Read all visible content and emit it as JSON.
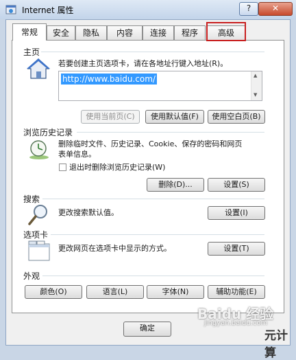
{
  "window": {
    "title": "Internet 属性",
    "help_label": "?",
    "close_label": "✕"
  },
  "tabs": [
    {
      "label": "常规",
      "active": true
    },
    {
      "label": "安全"
    },
    {
      "label": "隐私"
    },
    {
      "label": "内容"
    },
    {
      "label": "连接"
    },
    {
      "label": "程序"
    },
    {
      "label": "高级"
    }
  ],
  "home": {
    "label": "主页",
    "description": "若要创建主页选项卡，请在各地址行键入地址(R)。",
    "url": "http://www.baidu.com/",
    "use_current": "使用当前页(C)",
    "use_default": "使用默认值(F)",
    "use_blank": "使用空白页(B)"
  },
  "history": {
    "label": "浏览历史记录",
    "description_line1": "删除临时文件、历史记录、Cookie、保存的密码和网页",
    "description_line2": "表单信息。",
    "checkbox_label": "退出时删除浏览历史记录(W)",
    "delete_button": "删除(D)...",
    "settings_button": "设置(S)"
  },
  "search": {
    "label": "搜索",
    "description": "更改搜索默认值。",
    "settings_button": "设置(I)"
  },
  "tabs_section": {
    "label": "选项卡",
    "description": "更改网页在选项卡中显示的方式。",
    "settings_button": "设置(T)"
  },
  "appearance": {
    "label": "外观",
    "colors_button": "颜色(O)",
    "languages_button": "语言(L)",
    "fonts_button": "字体(N)",
    "accessibility_button": "辅助功能(E)"
  },
  "footer": {
    "ok_button": "确定"
  },
  "watermark": {
    "text": "Baidu 经验",
    "sub": "jingyan.baidu.com",
    "corner": "元计算"
  },
  "colors": {
    "tab_highlight": "#c81e1e",
    "selection": "#3399ff"
  }
}
